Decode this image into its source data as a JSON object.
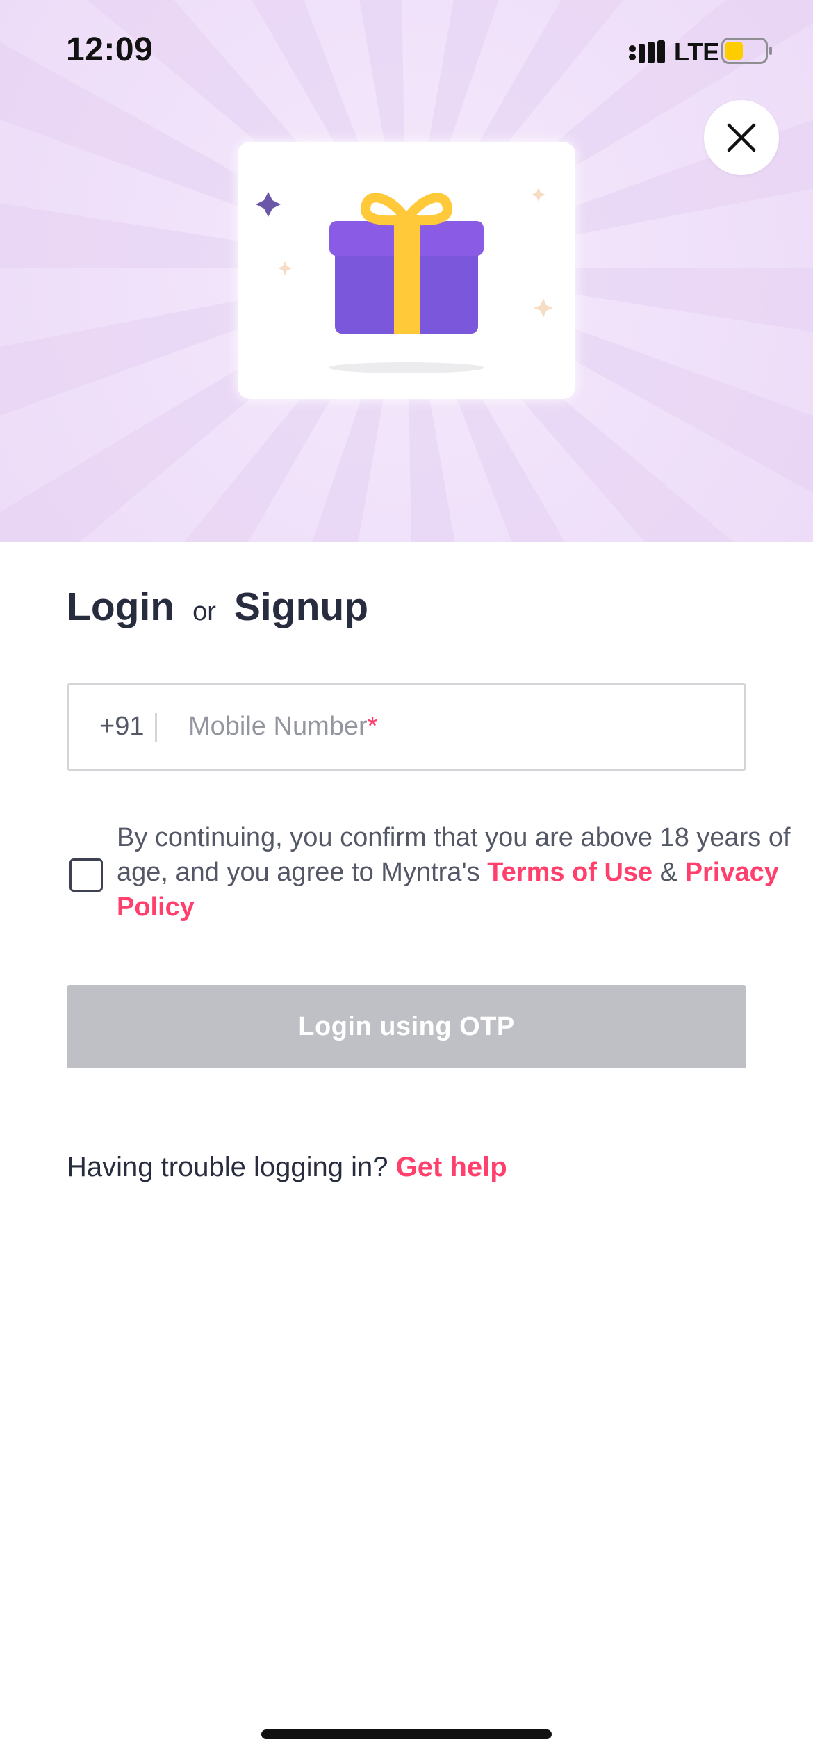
{
  "status_bar": {
    "time": "12:09",
    "network": "LTE",
    "battery_level": 0.45,
    "battery_color": "#ffcc00"
  },
  "hero": {
    "background_color": "#f1e3fa",
    "close_icon": "close-icon",
    "illustration": "gift-box-icon",
    "gift_color": "#7b4fe0",
    "ribbon_color": "#ffc93a"
  },
  "auth": {
    "title_login": "Login",
    "title_or": "or",
    "title_signup": "Signup"
  },
  "phone": {
    "country_code": "+91",
    "placeholder": "Mobile Number",
    "required_marker": "*",
    "value": ""
  },
  "consent": {
    "text_before": "By continuing, you confirm that you are above 18 years of age, and you agree to Myntra's ",
    "terms_label": "Terms of Use",
    "joiner": " & ",
    "privacy_label": "Privacy Policy",
    "checked": false
  },
  "actions": {
    "otp_label": "Login using OTP"
  },
  "help": {
    "prompt": "Having trouble logging in?",
    "link_label": "Get help"
  },
  "colors": {
    "accent": "#ff3f6c",
    "text_primary": "#282c3f",
    "button_disabled": "#bfc0c6"
  }
}
